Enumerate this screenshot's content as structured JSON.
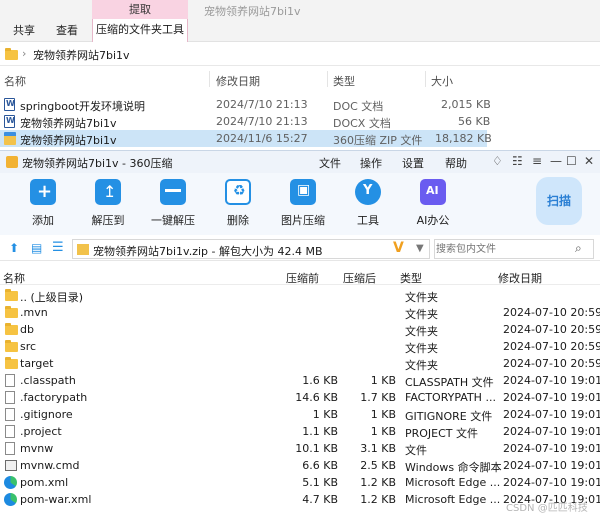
{
  "explorer": {
    "ribbon": {
      "tabs": [
        "共享",
        "查看"
      ],
      "context_head": "提取",
      "context_tab": "压缩的文件夹工具",
      "title": "宠物领养网站7bi1v"
    },
    "address": "宠物领养网站7bi1v",
    "columns": [
      "名称",
      "修改日期",
      "类型",
      "大小"
    ],
    "files": [
      {
        "name": "springboot开发环境说明",
        "date": "2024/7/10 21:13",
        "type": "DOC 文档",
        "size": "2,015 KB",
        "icon": "word-doc-icon"
      },
      {
        "name": "宠物领养网站7bi1v",
        "date": "2024/7/10 21:13",
        "type": "DOCX 文档",
        "size": "56 KB",
        "icon": "word-doc-icon"
      },
      {
        "name": "宠物领养网站7bi1v",
        "date": "2024/11/6 15:27",
        "type": "360压缩 ZIP 文件",
        "size": "18,182 KB",
        "icon": "zip-icon",
        "selected": true
      }
    ]
  },
  "zip_app": {
    "title": "宠物领养网站7bi1v - 360压缩",
    "menu": [
      "文件",
      "操作",
      "设置",
      "帮助"
    ],
    "tools": [
      {
        "label": "添加",
        "icon": "add-icon"
      },
      {
        "label": "解压到",
        "icon": "extract-to-icon"
      },
      {
        "label": "一键解压",
        "icon": "one-click-extract-icon"
      },
      {
        "label": "删除",
        "icon": "delete-icon"
      },
      {
        "label": "图片压缩",
        "icon": "image-compress-icon"
      },
      {
        "label": "工具",
        "icon": "tools-icon"
      },
      {
        "label": "AI办公",
        "icon": "ai-office-icon"
      }
    ],
    "scan_label": "扫描",
    "path": "宠物领养网站7bi1v.zip - 解包大小为 42.4 MB",
    "search_placeholder": "搜索包内文件",
    "columns": [
      "名称",
      "压缩前",
      "压缩后",
      "类型",
      "修改日期"
    ],
    "rows": [
      {
        "name": ".. (上级目录)",
        "before": "",
        "after": "",
        "type": "文件夹",
        "date": "",
        "icon": "folder-icon"
      },
      {
        "name": ".mvn",
        "before": "",
        "after": "",
        "type": "文件夹",
        "date": "2024-07-10 20:59",
        "icon": "folder-icon"
      },
      {
        "name": "db",
        "before": "",
        "after": "",
        "type": "文件夹",
        "date": "2024-07-10 20:59",
        "icon": "folder-icon"
      },
      {
        "name": "src",
        "before": "",
        "after": "",
        "type": "文件夹",
        "date": "2024-07-10 20:59",
        "icon": "folder-icon"
      },
      {
        "name": "target",
        "before": "",
        "after": "",
        "type": "文件夹",
        "date": "2024-07-10 20:59",
        "icon": "folder-icon"
      },
      {
        "name": ".classpath",
        "before": "1.6 KB",
        "after": "1 KB",
        "type": "CLASSPATH 文件",
        "date": "2024-07-10 19:01",
        "icon": "file-icon"
      },
      {
        "name": ".factorypath",
        "before": "14.6 KB",
        "after": "1.7 KB",
        "type": "FACTORYPATH ...",
        "date": "2024-07-10 19:01",
        "icon": "file-icon"
      },
      {
        "name": ".gitignore",
        "before": "1 KB",
        "after": "1 KB",
        "type": "GITIGNORE 文件",
        "date": "2024-07-10 19:01",
        "icon": "file-icon"
      },
      {
        "name": ".project",
        "before": "1.1 KB",
        "after": "1 KB",
        "type": "PROJECT 文件",
        "date": "2024-07-10 19:01",
        "icon": "file-icon"
      },
      {
        "name": "mvnw",
        "before": "10.1 KB",
        "after": "3.1 KB",
        "type": "文件",
        "date": "2024-07-10 19:01",
        "icon": "file-icon"
      },
      {
        "name": "mvnw.cmd",
        "before": "6.6 KB",
        "after": "2.5 KB",
        "type": "Windows 命令脚本",
        "date": "2024-07-10 19:01",
        "icon": "cmd-icon"
      },
      {
        "name": "pom.xml",
        "before": "5.1 KB",
        "after": "1.2 KB",
        "type": "Microsoft Edge ...",
        "date": "2024-07-10 19:01",
        "icon": "edge-icon"
      },
      {
        "name": "pom-war.xml",
        "before": "4.7 KB",
        "after": "1.2 KB",
        "type": "Microsoft Edge ...",
        "date": "2024-07-10 19:01",
        "icon": "edge-icon"
      }
    ],
    "watermark": "CSDN @匹匹科技"
  }
}
